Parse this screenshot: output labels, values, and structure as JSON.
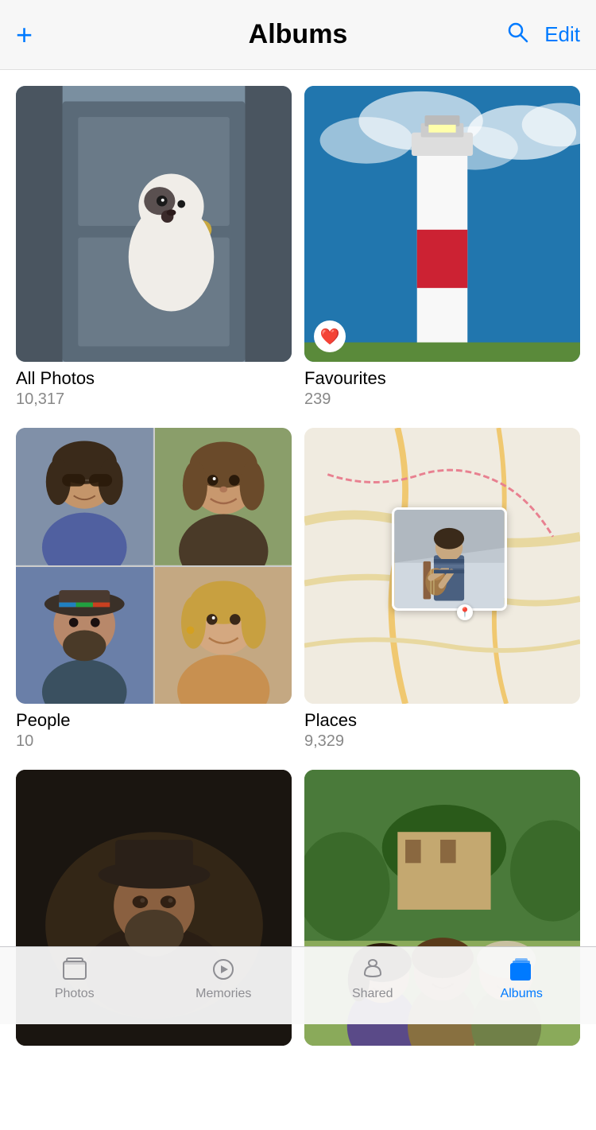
{
  "header": {
    "title": "Albums",
    "add_label": "+",
    "edit_label": "Edit"
  },
  "albums": [
    {
      "id": "all-photos",
      "name": "All Photos",
      "count": "10,317",
      "type": "single"
    },
    {
      "id": "favourites",
      "name": "Favourites",
      "count": "239",
      "type": "single",
      "has_heart": true
    },
    {
      "id": "people",
      "name": "People",
      "count": "10",
      "type": "people-grid"
    },
    {
      "id": "places",
      "name": "Places",
      "count": "9,329",
      "type": "places-map"
    },
    {
      "id": "album5",
      "name": "",
      "count": "",
      "type": "single-dark"
    },
    {
      "id": "album6",
      "name": "",
      "count": "",
      "type": "single-group"
    }
  ],
  "tab_bar": {
    "items": [
      {
        "id": "photos",
        "label": "Photos",
        "active": false
      },
      {
        "id": "memories",
        "label": "Memories",
        "active": false
      },
      {
        "id": "shared",
        "label": "Shared",
        "active": false
      },
      {
        "id": "albums",
        "label": "Albums",
        "active": true
      }
    ]
  }
}
